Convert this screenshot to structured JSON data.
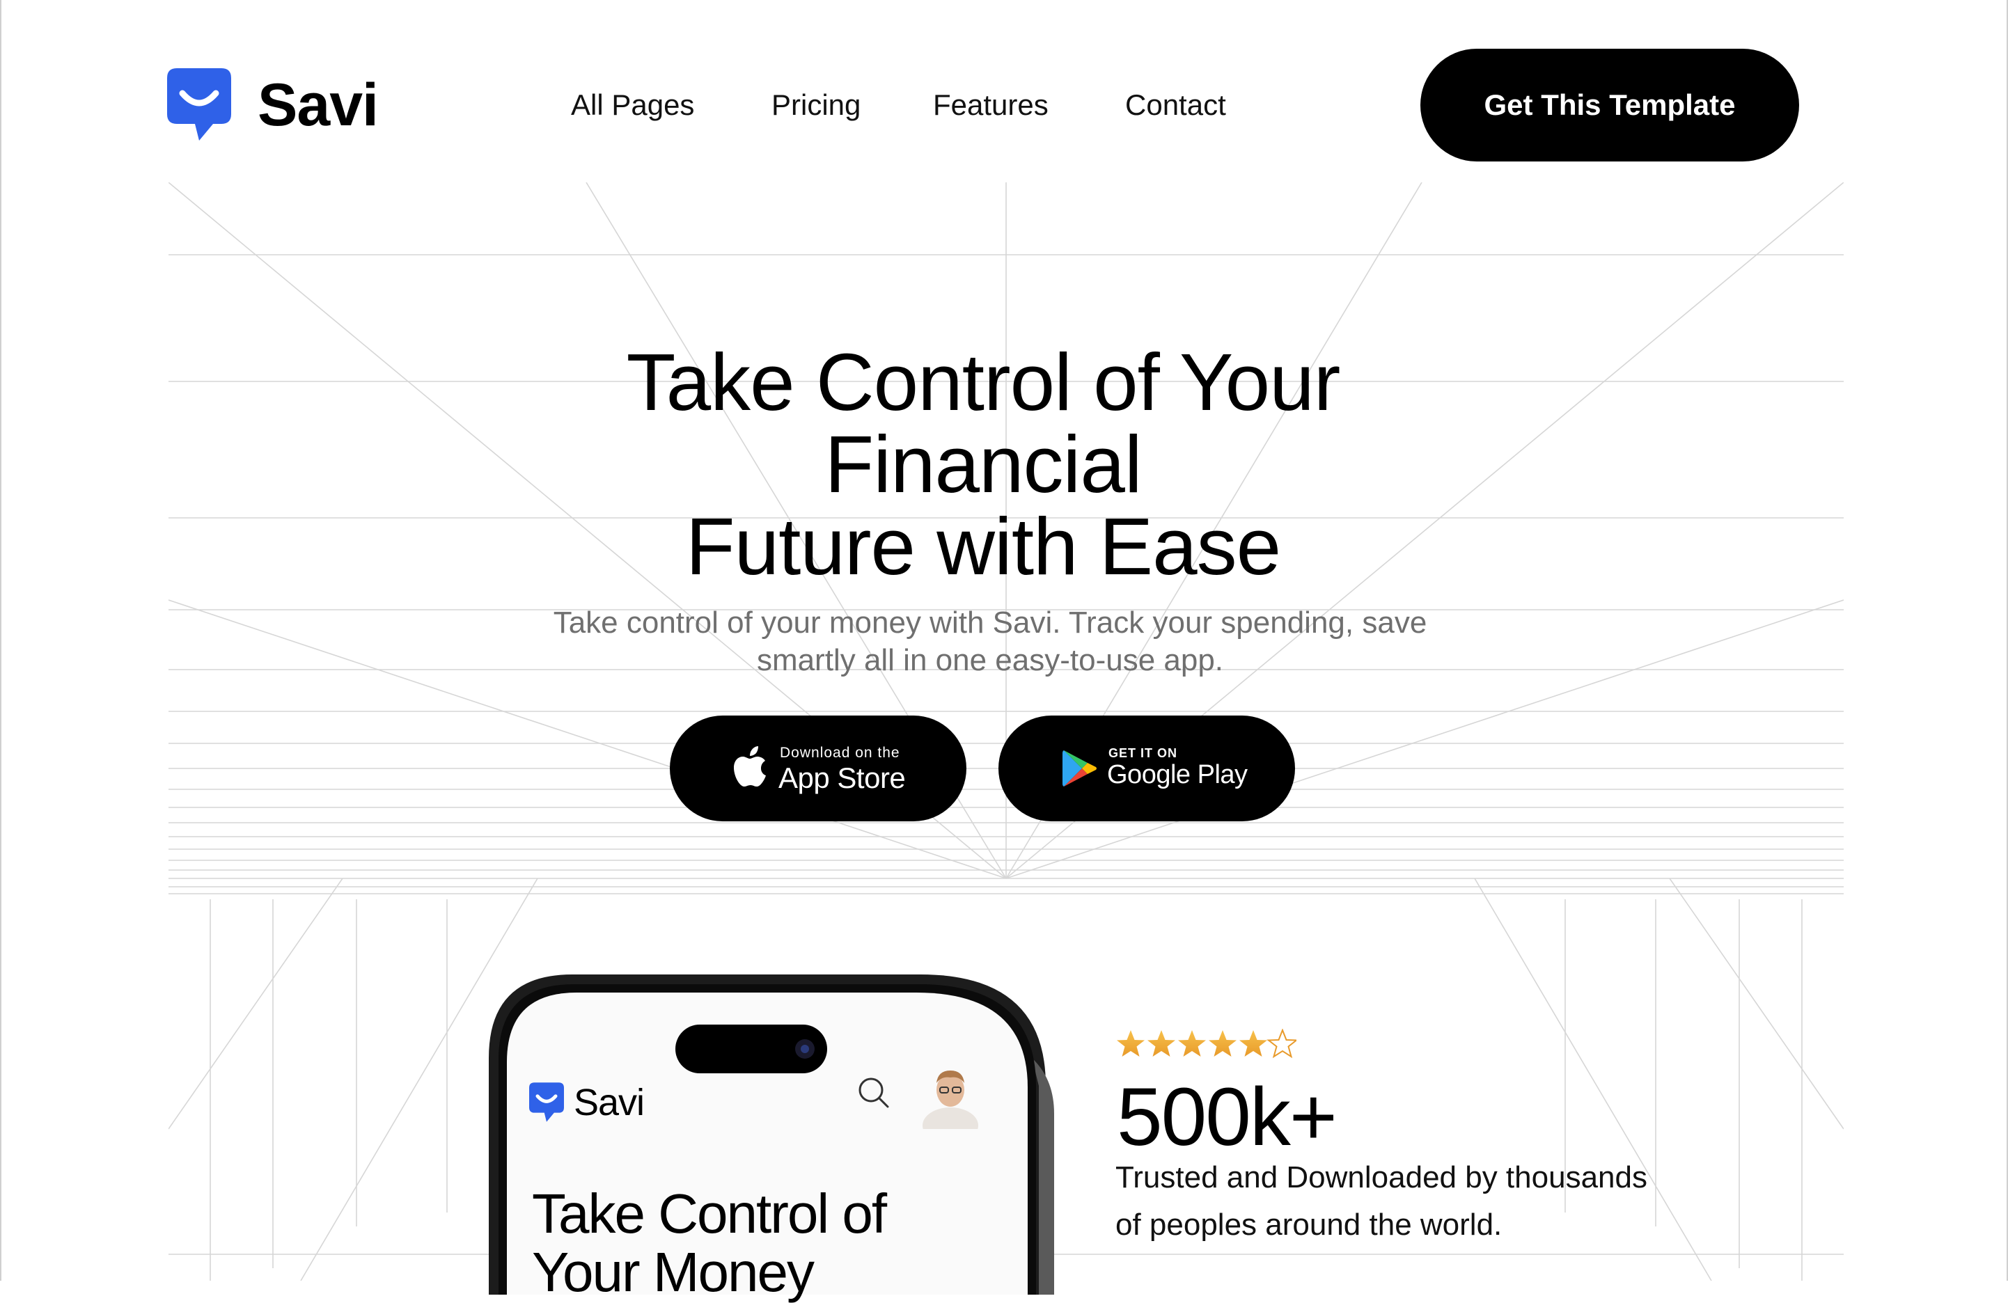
{
  "brand": {
    "name": "Savi",
    "accent": "#2F61E8"
  },
  "nav": {
    "links": [
      "All Pages",
      "Pricing",
      "Features",
      "Contact"
    ],
    "cta_label": "Get This Template"
  },
  "hero": {
    "title_lines": [
      "Take Control of Your",
      "Financial",
      "Future with Ease"
    ],
    "subtitle_lines": [
      "Take control of your money with Savi. Track your spending, save",
      "smartly all in one easy-to-use app."
    ]
  },
  "stores": {
    "apple": {
      "small": "Download on the",
      "big": "App Store",
      "icon": "apple-icon"
    },
    "google": {
      "small": "GET IT ON",
      "big": "Google Play",
      "icon": "google-play-icon"
    }
  },
  "phone": {
    "app_name": "Savi",
    "headline_lines": [
      "Take Control of",
      "Your Money"
    ]
  },
  "stats": {
    "rating_stars": 5,
    "number": "500k+",
    "description_lines": [
      "Trusted and Downloaded by thousands",
      "of peoples around the world."
    ]
  }
}
